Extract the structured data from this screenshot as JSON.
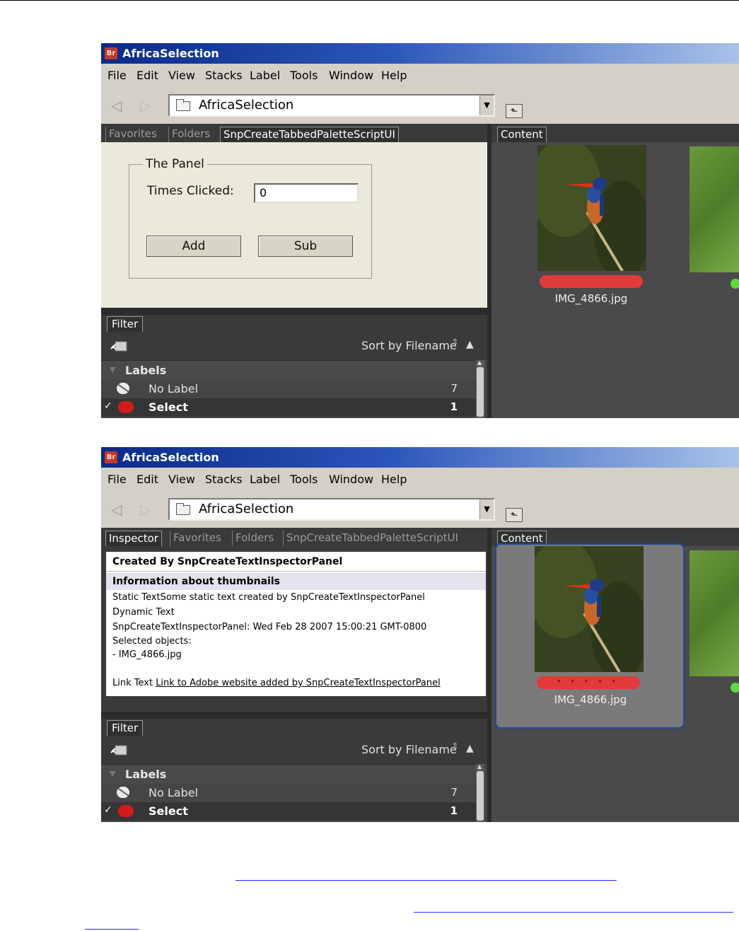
{
  "screenshot1": {
    "title": "AfricaSelection",
    "logo": "Br",
    "menu": [
      "File",
      "Edit",
      "View",
      "Stacks",
      "Label",
      "Tools",
      "Window",
      "Help"
    ],
    "path": "AfricaSelection",
    "tabs": [
      "Favorites",
      "Folders",
      "SnpCreateTabbedPaletteScriptUI"
    ],
    "active_tab_index": 2,
    "content_tab": "Content",
    "panel": {
      "group_title": "The Panel",
      "field_label": "Times Clicked:",
      "field_value": "0",
      "add_label": "Add",
      "sub_label": "Sub"
    },
    "thumbnail": {
      "filename": "IMG_4866.jpg",
      "label_color": "#e23a3a"
    },
    "filter": {
      "tab": "Filter",
      "sort_label": "Sort by Filename",
      "section": "Labels",
      "rows": [
        {
          "name": "No Label",
          "count": "7",
          "checked": false
        },
        {
          "name": "Select",
          "count": "1",
          "checked": true
        }
      ]
    }
  },
  "screenshot2": {
    "title": "AfricaSelection",
    "logo": "Br",
    "menu": [
      "File",
      "Edit",
      "View",
      "Stacks",
      "Label",
      "Tools",
      "Window",
      "Help"
    ],
    "path": "AfricaSelection",
    "tabs": [
      "Inspector",
      "Favorites",
      "Folders",
      "SnpCreateTabbedPaletteScriptUI"
    ],
    "active_tab_index": 0,
    "content_tab": "Content",
    "inspector": {
      "heading": "Created By SnpCreateTextInspectorPanel",
      "subheading": "Information about thumbnails",
      "static_label": "Static Text",
      "static_value": "Some static text created by SnpCreateTextInspectorPanel",
      "dynamic_text": "Dynamic Text",
      "dynamic_line": "SnpCreateTextInspectorPanel: Wed Feb 28 2007 15:00:21 GMT-0800",
      "selected_objects": "Selected objects:",
      "selected_item": "- IMG_4866.jpg",
      "link_label": "Link Text",
      "link_text": "Link to Adobe website added by SnpCreateTextInspectorPanel"
    },
    "thumbnail": {
      "filename": "IMG_4866.jpg",
      "label_color": "#e23a3a",
      "stars": "* * * * *"
    },
    "filter": {
      "tab": "Filter",
      "sort_label": "Sort by Filename",
      "section": "Labels",
      "rows": [
        {
          "name": "No Label",
          "count": "7",
          "checked": false
        },
        {
          "name": "Select",
          "count": "1",
          "checked": true
        }
      ]
    }
  },
  "colors": {
    "title_gradient_start": "#0a2a8a",
    "menu_bg": "#d4d0c8",
    "panel_bg": "#ebe9db",
    "dark_bg": "#3a3a3a",
    "label_red": "#e23a3a",
    "selection_border": "#1c4a9c",
    "page_link": "#1f2fff"
  },
  "icons": [
    "bridge-logo-icon",
    "back-arrow-icon",
    "forward-arrow-icon",
    "folder-icon",
    "dropdown-arrow-icon",
    "up-folder-icon",
    "new-filter-icon",
    "sort-arrows-icon",
    "sort-ascending-icon",
    "no-label-icon",
    "red-label-icon",
    "checkmark-icon"
  ]
}
